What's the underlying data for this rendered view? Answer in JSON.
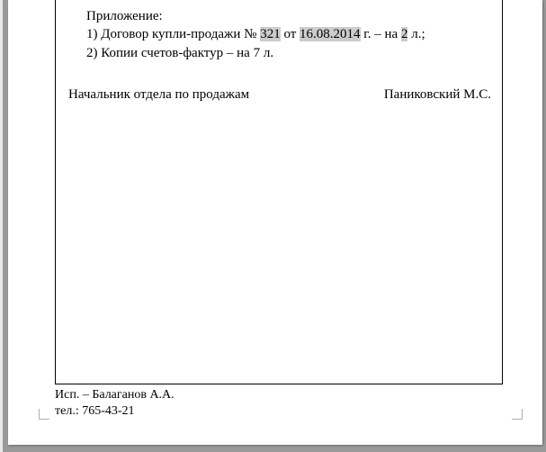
{
  "attachment": {
    "heading": "Приложение:",
    "item1_prefix": "1) Договор купли-продажи № ",
    "item1_num": "321",
    "item1_mid": " от ",
    "item1_date": "16.08.2014",
    "item1_mid2": " г. – на ",
    "item1_pages": "2",
    "item1_suffix": " л.;",
    "item2": "2) Копии счетов-фактур – на 7 л."
  },
  "signature": {
    "position": "Начальник отдела по продажам",
    "name": "Паниковский М.С."
  },
  "footer": {
    "executor": "Исп. – Балаганов А.А.",
    "phone": "тел.: 765-43-21"
  }
}
